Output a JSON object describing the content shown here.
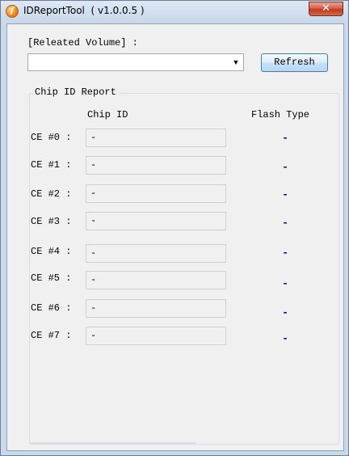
{
  "window": {
    "title": "IDReportTool  ( v1.0.0.5 )",
    "close_label": "✕"
  },
  "volume": {
    "label": "[Releated Volume] :",
    "selected": "",
    "arrow": "▼"
  },
  "refresh_label": "Refresh",
  "report": {
    "group_title": "Chip ID Report",
    "col_chip_id": "Chip ID",
    "col_flash_type": "Flash Type",
    "rows": [
      {
        "label": "CE #0 :",
        "chip_id": "-",
        "flash_type": "-"
      },
      {
        "label": "CE #1 :",
        "chip_id": "-",
        "flash_type": "-"
      },
      {
        "label": "CE #2 :",
        "chip_id": "-",
        "flash_type": "-"
      },
      {
        "label": "CE #3 :",
        "chip_id": "-",
        "flash_type": "-"
      },
      {
        "label": "CE #4 :",
        "chip_id": "-",
        "flash_type": "-"
      },
      {
        "label": "CE #5 :",
        "chip_id": "-",
        "flash_type": "-"
      },
      {
        "label": "CE #6 :",
        "chip_id": "-",
        "flash_type": "-"
      },
      {
        "label": "CE #7 :",
        "chip_id": "-",
        "flash_type": "-"
      }
    ]
  }
}
